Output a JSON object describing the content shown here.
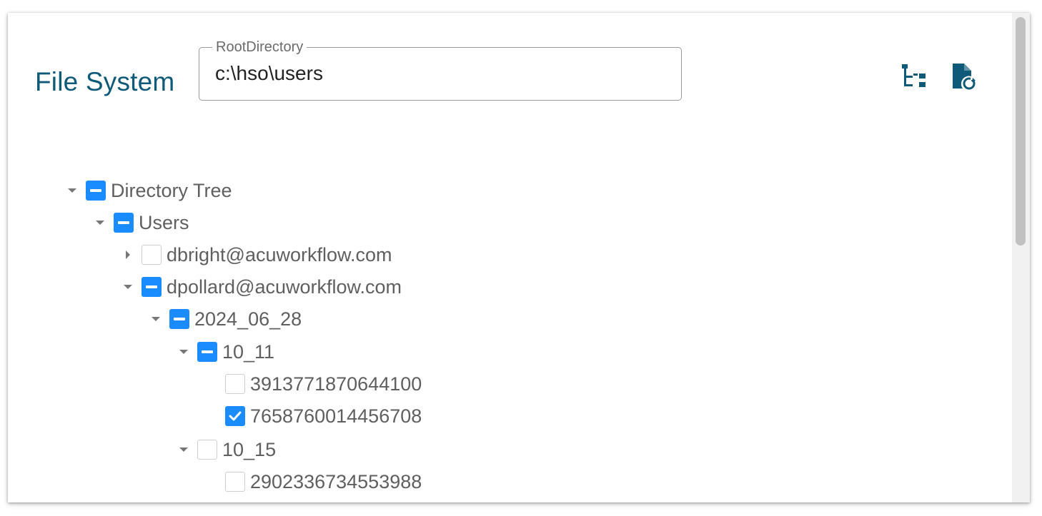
{
  "header": {
    "title": "File System",
    "root_field": {
      "label": "RootDirectory",
      "value": "c:\\hso\\users"
    },
    "actions": [
      {
        "name": "tree-view-icon"
      },
      {
        "name": "file-refresh-icon"
      }
    ]
  },
  "colors": {
    "accent": "#1a8cff",
    "title": "#0e5a78",
    "icon": "#0e5a78"
  },
  "tree": {
    "nodes": [
      {
        "label": "Directory Tree",
        "expander": "expanded",
        "check": "indeterminate"
      },
      {
        "label": "Users",
        "expander": "expanded",
        "check": "indeterminate"
      },
      {
        "label": "dbright@acuworkflow.com",
        "expander": "collapsed",
        "check": "unchecked"
      },
      {
        "label": "dpollard@acuworkflow.com",
        "expander": "expanded",
        "check": "indeterminate"
      },
      {
        "label": "2024_06_28",
        "expander": "expanded",
        "check": "indeterminate"
      },
      {
        "label": "10_11",
        "expander": "expanded",
        "check": "indeterminate"
      },
      {
        "label": "3913771870644100",
        "expander": "none",
        "check": "unchecked"
      },
      {
        "label": "7658760014456708",
        "expander": "none",
        "check": "checked"
      },
      {
        "label": "10_15",
        "expander": "expanded",
        "check": "unchecked"
      },
      {
        "label": "2902336734553988",
        "expander": "none",
        "check": "unchecked"
      }
    ]
  }
}
